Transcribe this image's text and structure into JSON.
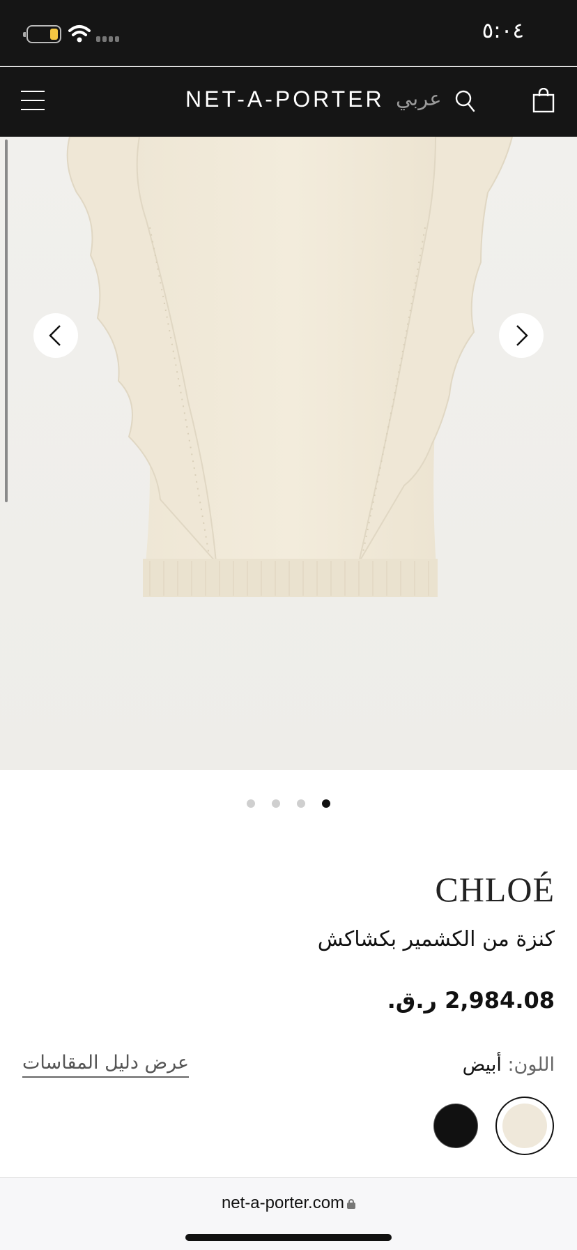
{
  "status_bar": {
    "time": "٥:٠٤"
  },
  "header": {
    "logo": "NET-A-PORTER",
    "language": "عربي"
  },
  "gallery": {
    "slide_count": 4,
    "active_index": 3
  },
  "product": {
    "brand": "CHLOÉ",
    "name": "كنزة من الكشمير بكشاكش",
    "price": "2,984.08 ر.ق.",
    "color_key": "اللون:",
    "color_value": "أبيض",
    "size_guide": "عرض دليل المقاسات",
    "swatches": [
      {
        "name": "ivory",
        "color": "#efe8da",
        "selected": true
      },
      {
        "name": "black",
        "color": "#111111",
        "selected": false
      }
    ]
  },
  "browser": {
    "url": "net-a-porter.com"
  }
}
